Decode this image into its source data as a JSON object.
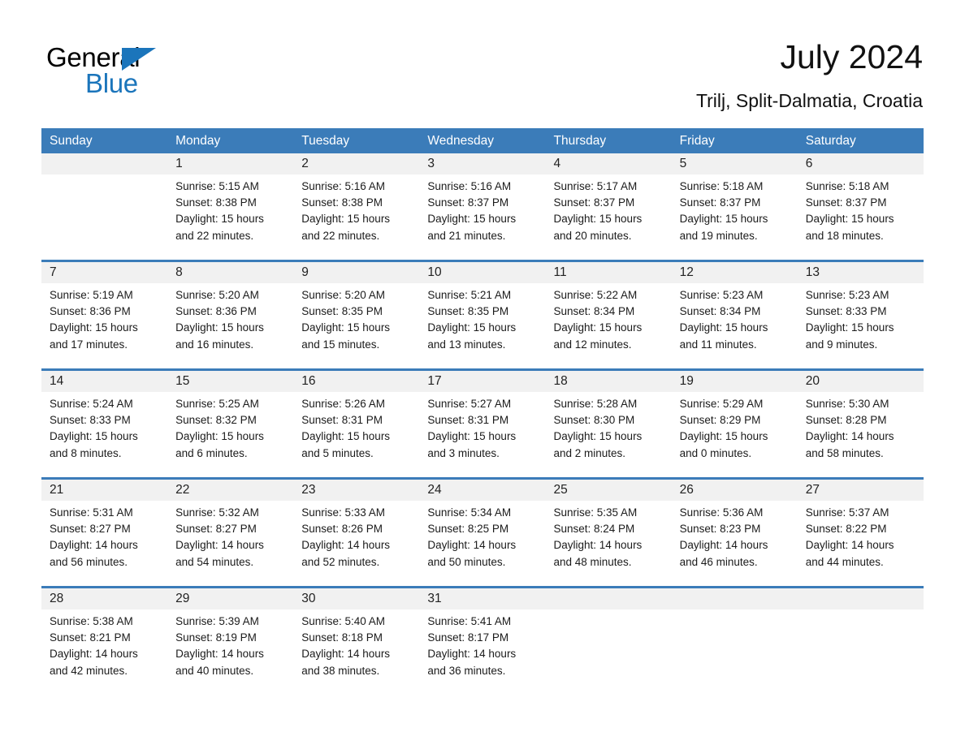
{
  "brand": {
    "name_part1": "General",
    "name_part2": "Blue",
    "accent_color": "#1b75bb",
    "triangle_icon": "triangle-icon"
  },
  "header": {
    "title": "July 2024",
    "location": "Trilj, Split-Dalmatia, Croatia"
  },
  "calendar": {
    "header_bg": "#3b7cb9",
    "daynum_bg": "#f1f1f1",
    "weekdays": [
      "Sunday",
      "Monday",
      "Tuesday",
      "Wednesday",
      "Thursday",
      "Friday",
      "Saturday"
    ],
    "weeks": [
      [
        {
          "day": "",
          "sunrise": "",
          "sunset": "",
          "daylight_l1": "",
          "daylight_l2": "",
          "empty": true
        },
        {
          "day": "1",
          "sunrise": "Sunrise: 5:15 AM",
          "sunset": "Sunset: 8:38 PM",
          "daylight_l1": "Daylight: 15 hours",
          "daylight_l2": "and 22 minutes."
        },
        {
          "day": "2",
          "sunrise": "Sunrise: 5:16 AM",
          "sunset": "Sunset: 8:38 PM",
          "daylight_l1": "Daylight: 15 hours",
          "daylight_l2": "and 22 minutes."
        },
        {
          "day": "3",
          "sunrise": "Sunrise: 5:16 AM",
          "sunset": "Sunset: 8:37 PM",
          "daylight_l1": "Daylight: 15 hours",
          "daylight_l2": "and 21 minutes."
        },
        {
          "day": "4",
          "sunrise": "Sunrise: 5:17 AM",
          "sunset": "Sunset: 8:37 PM",
          "daylight_l1": "Daylight: 15 hours",
          "daylight_l2": "and 20 minutes."
        },
        {
          "day": "5",
          "sunrise": "Sunrise: 5:18 AM",
          "sunset": "Sunset: 8:37 PM",
          "daylight_l1": "Daylight: 15 hours",
          "daylight_l2": "and 19 minutes."
        },
        {
          "day": "6",
          "sunrise": "Sunrise: 5:18 AM",
          "sunset": "Sunset: 8:37 PM",
          "daylight_l1": "Daylight: 15 hours",
          "daylight_l2": "and 18 minutes."
        }
      ],
      [
        {
          "day": "7",
          "sunrise": "Sunrise: 5:19 AM",
          "sunset": "Sunset: 8:36 PM",
          "daylight_l1": "Daylight: 15 hours",
          "daylight_l2": "and 17 minutes."
        },
        {
          "day": "8",
          "sunrise": "Sunrise: 5:20 AM",
          "sunset": "Sunset: 8:36 PM",
          "daylight_l1": "Daylight: 15 hours",
          "daylight_l2": "and 16 minutes."
        },
        {
          "day": "9",
          "sunrise": "Sunrise: 5:20 AM",
          "sunset": "Sunset: 8:35 PM",
          "daylight_l1": "Daylight: 15 hours",
          "daylight_l2": "and 15 minutes."
        },
        {
          "day": "10",
          "sunrise": "Sunrise: 5:21 AM",
          "sunset": "Sunset: 8:35 PM",
          "daylight_l1": "Daylight: 15 hours",
          "daylight_l2": "and 13 minutes."
        },
        {
          "day": "11",
          "sunrise": "Sunrise: 5:22 AM",
          "sunset": "Sunset: 8:34 PM",
          "daylight_l1": "Daylight: 15 hours",
          "daylight_l2": "and 12 minutes."
        },
        {
          "day": "12",
          "sunrise": "Sunrise: 5:23 AM",
          "sunset": "Sunset: 8:34 PM",
          "daylight_l1": "Daylight: 15 hours",
          "daylight_l2": "and 11 minutes."
        },
        {
          "day": "13",
          "sunrise": "Sunrise: 5:23 AM",
          "sunset": "Sunset: 8:33 PM",
          "daylight_l1": "Daylight: 15 hours",
          "daylight_l2": "and 9 minutes."
        }
      ],
      [
        {
          "day": "14",
          "sunrise": "Sunrise: 5:24 AM",
          "sunset": "Sunset: 8:33 PM",
          "daylight_l1": "Daylight: 15 hours",
          "daylight_l2": "and 8 minutes."
        },
        {
          "day": "15",
          "sunrise": "Sunrise: 5:25 AM",
          "sunset": "Sunset: 8:32 PM",
          "daylight_l1": "Daylight: 15 hours",
          "daylight_l2": "and 6 minutes."
        },
        {
          "day": "16",
          "sunrise": "Sunrise: 5:26 AM",
          "sunset": "Sunset: 8:31 PM",
          "daylight_l1": "Daylight: 15 hours",
          "daylight_l2": "and 5 minutes."
        },
        {
          "day": "17",
          "sunrise": "Sunrise: 5:27 AM",
          "sunset": "Sunset: 8:31 PM",
          "daylight_l1": "Daylight: 15 hours",
          "daylight_l2": "and 3 minutes."
        },
        {
          "day": "18",
          "sunrise": "Sunrise: 5:28 AM",
          "sunset": "Sunset: 8:30 PM",
          "daylight_l1": "Daylight: 15 hours",
          "daylight_l2": "and 2 minutes."
        },
        {
          "day": "19",
          "sunrise": "Sunrise: 5:29 AM",
          "sunset": "Sunset: 8:29 PM",
          "daylight_l1": "Daylight: 15 hours",
          "daylight_l2": "and 0 minutes."
        },
        {
          "day": "20",
          "sunrise": "Sunrise: 5:30 AM",
          "sunset": "Sunset: 8:28 PM",
          "daylight_l1": "Daylight: 14 hours",
          "daylight_l2": "and 58 minutes."
        }
      ],
      [
        {
          "day": "21",
          "sunrise": "Sunrise: 5:31 AM",
          "sunset": "Sunset: 8:27 PM",
          "daylight_l1": "Daylight: 14 hours",
          "daylight_l2": "and 56 minutes."
        },
        {
          "day": "22",
          "sunrise": "Sunrise: 5:32 AM",
          "sunset": "Sunset: 8:27 PM",
          "daylight_l1": "Daylight: 14 hours",
          "daylight_l2": "and 54 minutes."
        },
        {
          "day": "23",
          "sunrise": "Sunrise: 5:33 AM",
          "sunset": "Sunset: 8:26 PM",
          "daylight_l1": "Daylight: 14 hours",
          "daylight_l2": "and 52 minutes."
        },
        {
          "day": "24",
          "sunrise": "Sunrise: 5:34 AM",
          "sunset": "Sunset: 8:25 PM",
          "daylight_l1": "Daylight: 14 hours",
          "daylight_l2": "and 50 minutes."
        },
        {
          "day": "25",
          "sunrise": "Sunrise: 5:35 AM",
          "sunset": "Sunset: 8:24 PM",
          "daylight_l1": "Daylight: 14 hours",
          "daylight_l2": "and 48 minutes."
        },
        {
          "day": "26",
          "sunrise": "Sunrise: 5:36 AM",
          "sunset": "Sunset: 8:23 PM",
          "daylight_l1": "Daylight: 14 hours",
          "daylight_l2": "and 46 minutes."
        },
        {
          "day": "27",
          "sunrise": "Sunrise: 5:37 AM",
          "sunset": "Sunset: 8:22 PM",
          "daylight_l1": "Daylight: 14 hours",
          "daylight_l2": "and 44 minutes."
        }
      ],
      [
        {
          "day": "28",
          "sunrise": "Sunrise: 5:38 AM",
          "sunset": "Sunset: 8:21 PM",
          "daylight_l1": "Daylight: 14 hours",
          "daylight_l2": "and 42 minutes."
        },
        {
          "day": "29",
          "sunrise": "Sunrise: 5:39 AM",
          "sunset": "Sunset: 8:19 PM",
          "daylight_l1": "Daylight: 14 hours",
          "daylight_l2": "and 40 minutes."
        },
        {
          "day": "30",
          "sunrise": "Sunrise: 5:40 AM",
          "sunset": "Sunset: 8:18 PM",
          "daylight_l1": "Daylight: 14 hours",
          "daylight_l2": "and 38 minutes."
        },
        {
          "day": "31",
          "sunrise": "Sunrise: 5:41 AM",
          "sunset": "Sunset: 8:17 PM",
          "daylight_l1": "Daylight: 14 hours",
          "daylight_l2": "and 36 minutes."
        },
        {
          "day": "",
          "sunrise": "",
          "sunset": "",
          "daylight_l1": "",
          "daylight_l2": "",
          "empty": true
        },
        {
          "day": "",
          "sunrise": "",
          "sunset": "",
          "daylight_l1": "",
          "daylight_l2": "",
          "empty": true
        },
        {
          "day": "",
          "sunrise": "",
          "sunset": "",
          "daylight_l1": "",
          "daylight_l2": "",
          "empty": true
        }
      ]
    ]
  }
}
